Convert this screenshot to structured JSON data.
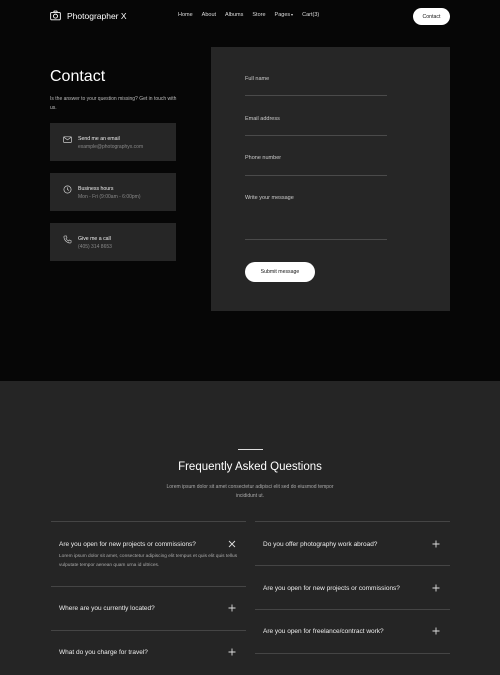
{
  "header": {
    "brand": "Photographer X",
    "nav": [
      "Home",
      "About",
      "Albums",
      "Store",
      "Pages",
      "Cart(3)"
    ],
    "contact_button": "Contact"
  },
  "contact": {
    "title": "Contact",
    "subtitle": "Is the answer to your question missing? Get in touch with us.",
    "cards": [
      {
        "icon": "mail-icon",
        "title": "Send me an email",
        "detail": "example@photographyx.com"
      },
      {
        "icon": "clock-icon",
        "title": "Business hours",
        "detail": "Mon - Fri (9:00am - 6:00pm)"
      },
      {
        "icon": "phone-icon",
        "title": "Give me a call",
        "detail": "(405) 314 8653"
      }
    ]
  },
  "form": {
    "full_name": "Full name",
    "email": "Email address",
    "phone": "Phone number",
    "message": "Write your message",
    "submit": "Submit message"
  },
  "faq": {
    "title": "Frequently Asked Questions",
    "subtitle": "Lorem ipsum dolor sit amet consectetur adipisci elit sed do eiusmod tempor incididunt ut.",
    "left": [
      {
        "question": "Are you open for new projects or commissions?",
        "answer": "Lorem ipsum dolor sit amet, consectetur adipiscing elit tempus et quis elit quis tellus vulputate tempor aenean quam urna id ultrices.",
        "open": true
      },
      {
        "question": "Where are you currently located?",
        "open": false
      },
      {
        "question": "What do you charge for travel?",
        "open": false
      }
    ],
    "right": [
      {
        "question": "Do you offer photography work abroad?",
        "open": false
      },
      {
        "question": "Are you open for new projects or commissions?",
        "open": false
      },
      {
        "question": "Are you open for freelance/contract work?",
        "open": false
      }
    ]
  },
  "colors": {
    "page_bg": "#060606",
    "panel_bg": "#262626",
    "faq_bg": "#252525",
    "accent": "#ffffff"
  }
}
